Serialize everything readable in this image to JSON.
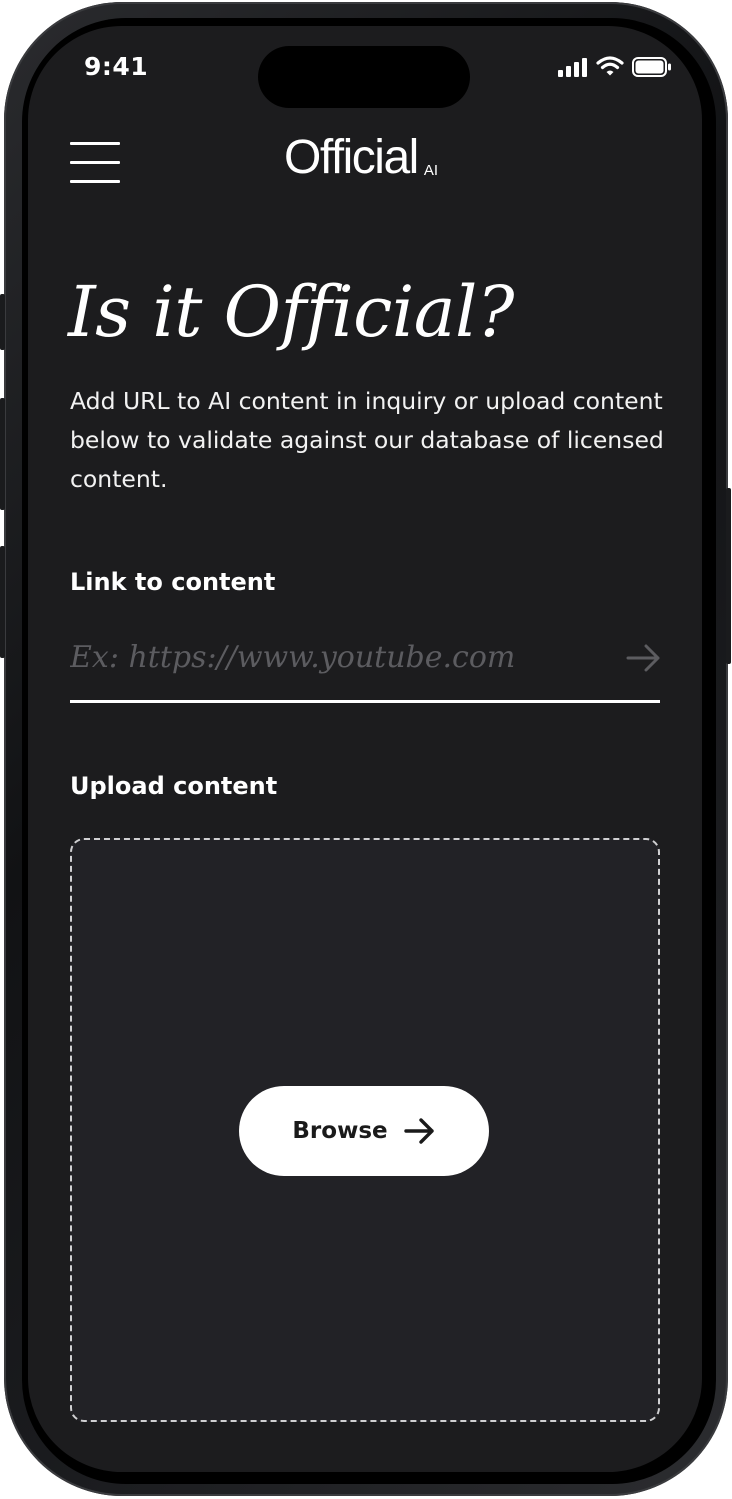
{
  "status_bar": {
    "time": "9:41"
  },
  "header": {
    "menu_icon": "hamburger-menu-icon",
    "logo_text": "Official",
    "logo_suffix": "AI"
  },
  "hero": {
    "title": "Is it Official?",
    "description": "Add URL to AI content in inquiry or upload content below to validate against our database of licensed content."
  },
  "link_section": {
    "label": "Link to content",
    "placeholder": "Ex: https://www.youtube.com",
    "value": "",
    "submit_icon": "arrow-right-icon"
  },
  "upload_section": {
    "label": "Upload content",
    "browse_label": "Browse",
    "browse_icon": "arrow-right-icon"
  },
  "colors": {
    "background": "#1c1c1e",
    "text": "#ffffff",
    "placeholder": "#5c5c60",
    "dropzone_fill": "#222226",
    "button_fill": "#ffffff",
    "button_text": "#1a1a1a"
  }
}
